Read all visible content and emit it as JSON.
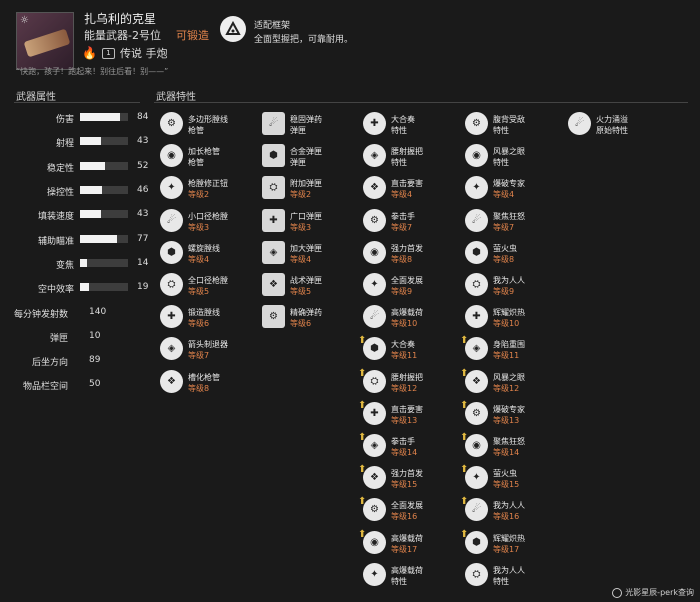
{
  "weapon": {
    "name": "扎乌利的克星",
    "type": "能量武器-2号位",
    "forge_label": "可锻造",
    "level_badge": "1",
    "rarity_class": "传说 手炮",
    "quote": "“快跑，孩子！跑起来！别往后看！别——”"
  },
  "frame": {
    "label": "适配框架",
    "desc": "全面型握把，可靠耐用。",
    "icon": "triangle-frame-icon"
  },
  "stats_title": "武器属性",
  "perks_title": "武器特性",
  "stats": [
    {
      "label": "伤害",
      "value": "84",
      "fill": 0.84
    },
    {
      "label": "射程",
      "value": "43",
      "fill": 0.43
    },
    {
      "label": "稳定性",
      "value": "52",
      "fill": 0.52
    },
    {
      "label": "操控性",
      "value": "46",
      "fill": 0.46
    },
    {
      "label": "填装速度",
      "value": "43",
      "fill": 0.43
    },
    {
      "label": "辅助瞄准",
      "value": "77",
      "fill": 0.77
    },
    {
      "label": "变焦",
      "value": "14",
      "fill": 0.14
    },
    {
      "label": "空中效率",
      "value": "19",
      "fill": 0.19
    }
  ],
  "num_stats": [
    {
      "label": "每分钟发射数",
      "value": "140"
    },
    {
      "label": "弹匣",
      "value": "10"
    },
    {
      "label": "后坐方向",
      "value": "89"
    },
    {
      "label": "物品栏空间",
      "value": "50"
    }
  ],
  "perk_cols": [
    [
      {
        "name": "多边形膛线",
        "level": "枪管"
      },
      {
        "name": "加长枪管",
        "level": "枪管"
      },
      {
        "name": "枪膛修正钮",
        "level": "等级2"
      },
      {
        "name": "小口径枪膛",
        "level": "等级3"
      },
      {
        "name": "螺旋膛线",
        "level": "等级4"
      },
      {
        "name": "全口径枪膛",
        "level": "等级5"
      },
      {
        "name": "锻造膛线",
        "level": "等级6"
      },
      {
        "name": "箭头制退器",
        "level": "等级7"
      },
      {
        "name": "槽化枪管",
        "level": "等级8"
      }
    ],
    [
      {
        "name": "稳固弹药",
        "level": "弹匣"
      },
      {
        "name": "合金弹匣",
        "level": "弹匣"
      },
      {
        "name": "附加弹匣",
        "level": "等级2"
      },
      {
        "name": "广口弹匣",
        "level": "等级3"
      },
      {
        "name": "加大弹匣",
        "level": "等级4"
      },
      {
        "name": "战术弹匣",
        "level": "等级5"
      },
      {
        "name": "精确弹药",
        "level": "等级6"
      }
    ],
    [
      {
        "name": "大合奏",
        "level": "特性"
      },
      {
        "name": "腰射握把",
        "level": "特性"
      },
      {
        "name": "直击要害",
        "level": "等级4"
      },
      {
        "name": "拳击手",
        "level": "等级7"
      },
      {
        "name": "强力首发",
        "level": "等级8"
      },
      {
        "name": "全面发展",
        "level": "等级9"
      },
      {
        "name": "高爆载荷",
        "level": "等级10"
      },
      {
        "name": "大合奏",
        "level": "等级11"
      },
      {
        "name": "腰射握把",
        "level": "等级12"
      },
      {
        "name": "直击要害",
        "level": "等级13"
      },
      {
        "name": "拳击手",
        "level": "等级14"
      },
      {
        "name": "强力首发",
        "level": "等级15"
      },
      {
        "name": "全面发展",
        "level": "等级16"
      },
      {
        "name": "高爆载荷",
        "level": "等级17"
      },
      {
        "name": "高爆载荷",
        "level": "特性"
      }
    ],
    [
      {
        "name": "腹背受敌",
        "level": "特性"
      },
      {
        "name": "风暴之眼",
        "level": "特性"
      },
      {
        "name": "爆破专家",
        "level": "等级4"
      },
      {
        "name": "聚焦狂怒",
        "level": "等级7"
      },
      {
        "name": "萤火虫",
        "level": "等级8"
      },
      {
        "name": "我为人人",
        "level": "等级9"
      },
      {
        "name": "辉耀炽热",
        "level": "等级10"
      },
      {
        "name": "身陷重围",
        "level": "等级11"
      },
      {
        "name": "风暴之眼",
        "level": "等级12"
      },
      {
        "name": "爆破专家",
        "level": "等级13"
      },
      {
        "name": "聚焦狂怒",
        "level": "等级14"
      },
      {
        "name": "萤火虫",
        "level": "等级15"
      },
      {
        "name": "我为人人",
        "level": "等级16"
      },
      {
        "name": "辉耀炽热",
        "level": "等级17"
      },
      {
        "name": "我为人人",
        "level": "特性"
      }
    ],
    [
      {
        "name": "火力涌溢",
        "level": "原始特性"
      }
    ]
  ],
  "footer": "光影星辰-perk查询"
}
